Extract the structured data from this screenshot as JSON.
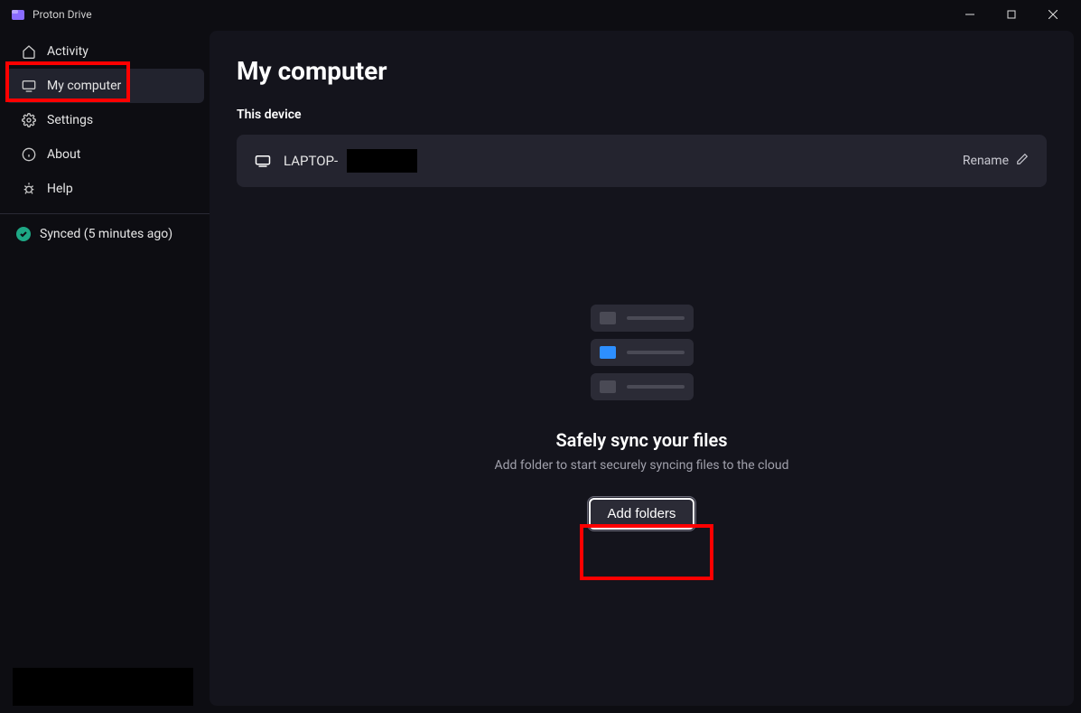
{
  "titlebar": {
    "app_name": "Proton Drive"
  },
  "sidebar": {
    "items": [
      {
        "label": "Activity"
      },
      {
        "label": "My computer"
      },
      {
        "label": "Settings"
      },
      {
        "label": "About"
      },
      {
        "label": "Help"
      }
    ],
    "sync_status": "Synced (5 minutes ago)"
  },
  "main": {
    "title": "My computer",
    "section_label": "This device",
    "device_name_prefix": "LAPTOP-",
    "rename_label": "Rename",
    "empty": {
      "title": "Safely sync your files",
      "subtitle": "Add folder to start securely syncing files to the cloud",
      "button": "Add folders"
    }
  }
}
